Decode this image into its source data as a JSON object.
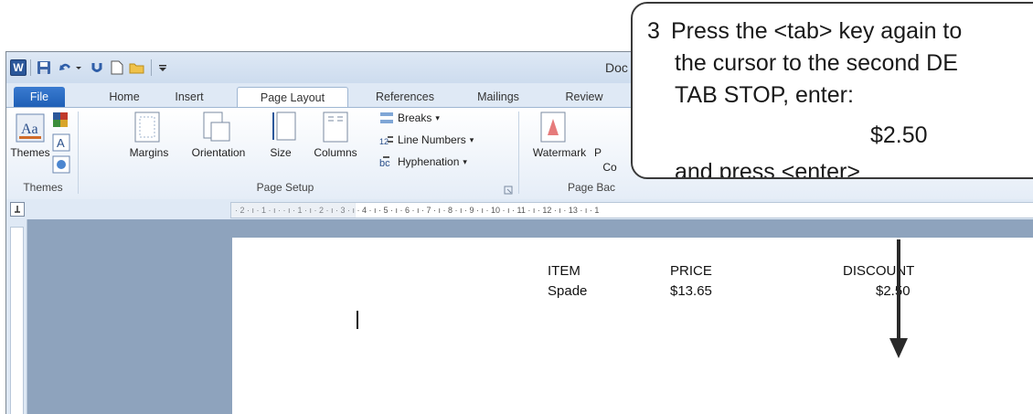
{
  "window": {
    "doc_title": "Doc"
  },
  "tabs": [
    "File",
    "Home",
    "Insert",
    "Page Layout",
    "References",
    "Mailings",
    "Review"
  ],
  "ribbon": {
    "themes": {
      "themes_label": "Themes",
      "group_label": "Themes"
    },
    "page_setup": {
      "margins": "Margins",
      "orientation": "Orientation",
      "size": "Size",
      "columns": "Columns",
      "breaks": "Breaks",
      "line_numbers": "Line Numbers",
      "hyphenation": "Hyphenation",
      "group_label": "Page Setup"
    },
    "page_background": {
      "watermark": "Watermark",
      "p_label": "P",
      "co_label": "Co",
      "group_label": "Page Bac"
    }
  },
  "ruler": {
    "text": "· 2 · ı · 1 · ı ·   · ı · 1 · ı · 2 · ı · 3 · ı · 4 · ı · 5 · ı · 6 · ı · 7 · ı · 8 · ı · 9 · ı · 10 · ı · 11 · ı · 12 · ı · 13 · ı · 1"
  },
  "table": {
    "headers": [
      "ITEM",
      "PRICE",
      "DISCOUNT"
    ],
    "rows": [
      [
        "Spade",
        "$13.65",
        "$2.50"
      ]
    ]
  },
  "callout": {
    "step_number": "3",
    "line1": "Press the <tab> key again to",
    "line2": "the cursor to the second DE",
    "line3": "TAB STOP, enter:",
    "value": "$2.50",
    "line4": "and press <enter>"
  },
  "colors": {
    "file_tab": "#2a6bc6",
    "ribbon_bg": "#dfe9f5",
    "callout_border": "#3a3a3a"
  }
}
